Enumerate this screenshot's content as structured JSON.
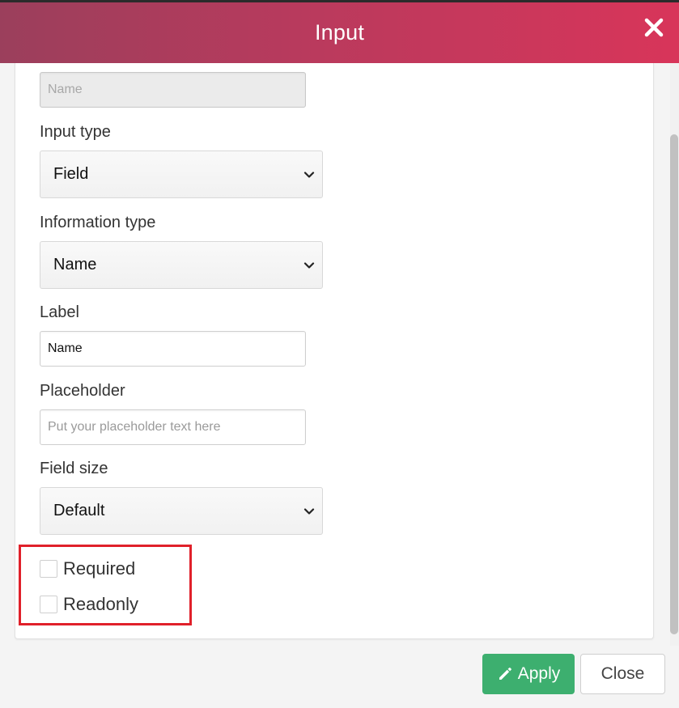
{
  "dialog": {
    "title": "Input",
    "close_icon": "close-icon"
  },
  "form": {
    "name_field": {
      "placeholder": "Name",
      "value": ""
    },
    "input_type": {
      "label": "Input type",
      "selected": "Field"
    },
    "information_type": {
      "label": "Information type",
      "selected": "Name"
    },
    "label_field": {
      "label": "Label",
      "value": "Name"
    },
    "placeholder_field": {
      "label": "Placeholder",
      "placeholder": "Put your placeholder text here",
      "value": ""
    },
    "field_size": {
      "label": "Field size",
      "selected": "Default"
    },
    "required": {
      "label": "Required",
      "checked": false
    },
    "readonly": {
      "label": "Readonly",
      "checked": false
    }
  },
  "footer": {
    "apply_label": "Apply",
    "apply_icon": "pencil-icon",
    "close_label": "Close"
  },
  "colors": {
    "header_start": "#9b3f5c",
    "header_end": "#d8355a",
    "apply_green": "#3daf6f",
    "highlight_red": "#e0202a"
  }
}
